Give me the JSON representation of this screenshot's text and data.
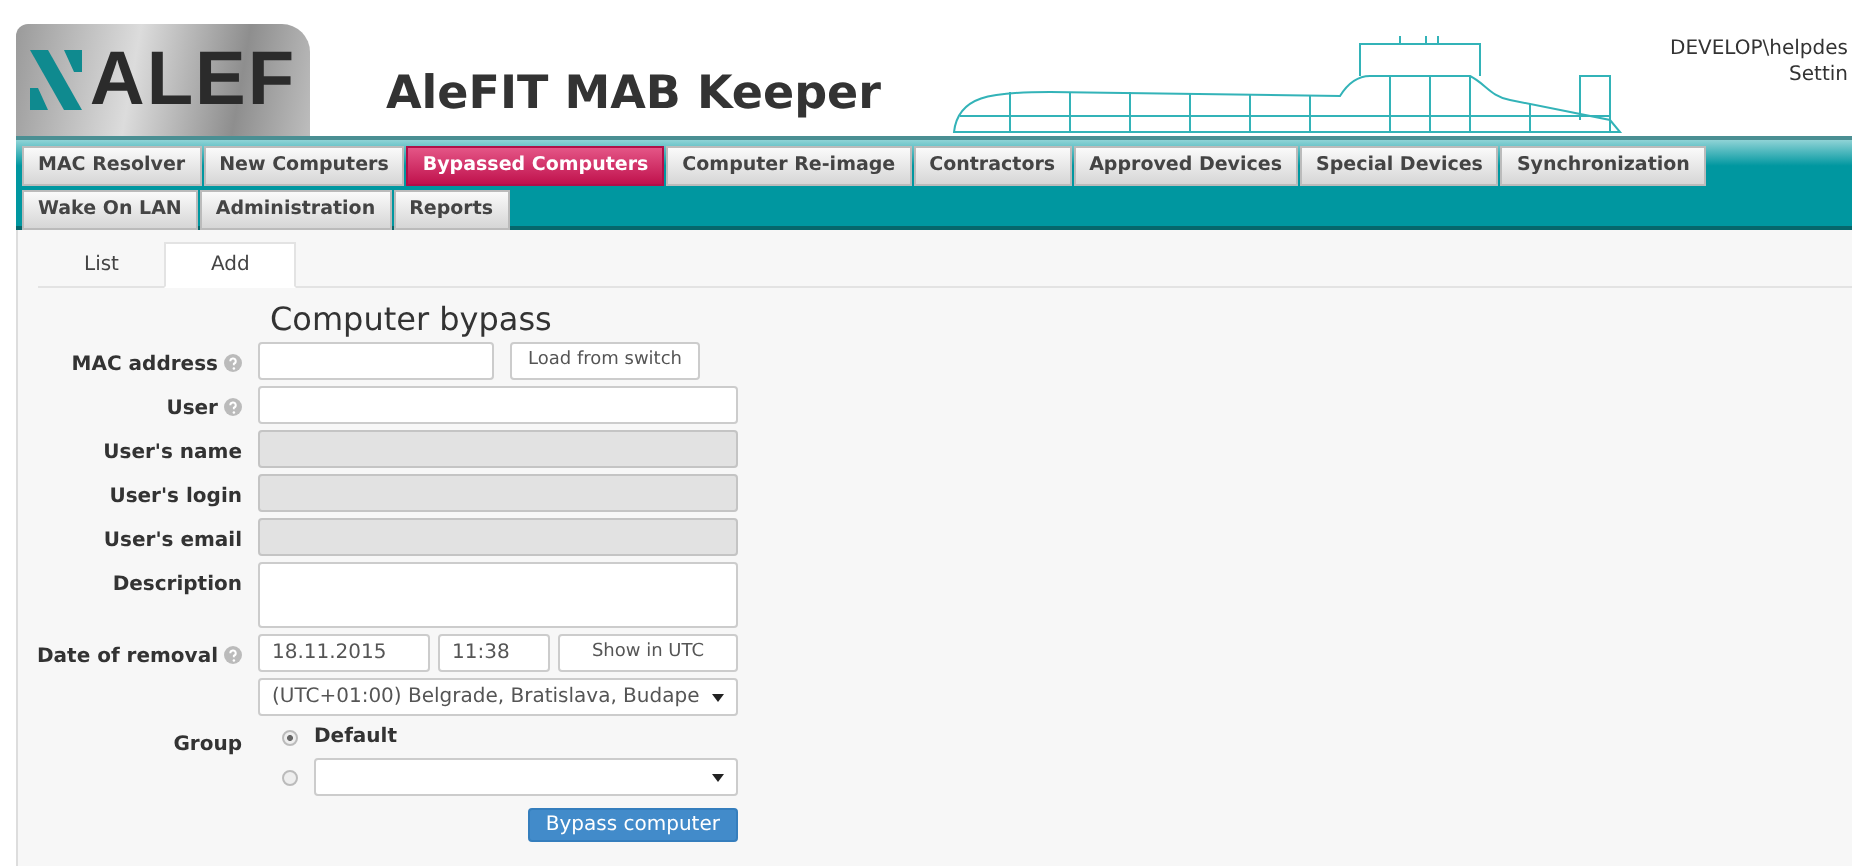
{
  "header": {
    "logo_text": "ALEF",
    "title": "AleFIT MAB Keeper",
    "user": "DEVELOP\\helpdes",
    "settings_link": "Settin"
  },
  "nav_tabs": [
    {
      "label": "MAC Resolver",
      "selected": false
    },
    {
      "label": "New Computers",
      "selected": false
    },
    {
      "label": "Bypassed Computers",
      "selected": true
    },
    {
      "label": "Computer Re-image",
      "selected": false
    },
    {
      "label": "Contractors",
      "selected": false
    },
    {
      "label": "Approved Devices",
      "selected": false
    },
    {
      "label": "Special Devices",
      "selected": false
    },
    {
      "label": "Synchronization",
      "selected": false
    },
    {
      "label": "Wake On LAN",
      "selected": false
    },
    {
      "label": "Administration",
      "selected": false
    },
    {
      "label": "Reports",
      "selected": false
    }
  ],
  "sub_tabs": [
    {
      "label": "List",
      "selected": false
    },
    {
      "label": "Add",
      "selected": true
    }
  ],
  "form": {
    "heading": "Computer bypass",
    "fields": [
      {
        "kind": "input",
        "label": "MAC address",
        "help": true,
        "disabled": false,
        "button": "Load from switch"
      },
      {
        "kind": "input",
        "label": "User",
        "help": true,
        "disabled": false
      },
      {
        "kind": "input",
        "label": "User's name",
        "help": false,
        "disabled": true
      },
      {
        "kind": "input",
        "label": "User's login",
        "help": false,
        "disabled": true
      },
      {
        "kind": "input",
        "label": "User's email",
        "help": false,
        "disabled": true
      },
      {
        "kind": "textarea",
        "label": "Description",
        "help": false
      },
      {
        "kind": "datetime",
        "label": "Date of removal",
        "help": true,
        "date": "18.11.2015",
        "time": "11:38",
        "button": "Show in UTC",
        "timezone": "(UTC+01:00) Belgrade, Bratislava, Budape"
      },
      {
        "kind": "radio",
        "label": "Group",
        "help": false,
        "options": [
          {
            "kind": "label",
            "label": "Default",
            "selected": true
          },
          {
            "kind": "select",
            "selected": false
          }
        ]
      }
    ],
    "submit": "Bypass computer"
  }
}
